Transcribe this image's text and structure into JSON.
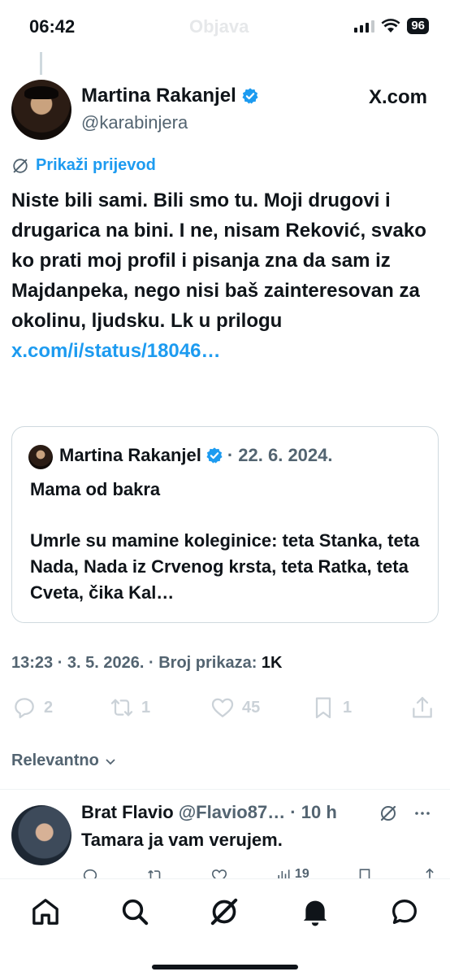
{
  "status_bar": {
    "time": "06:42",
    "title": "Objava",
    "battery": "96"
  },
  "tweet": {
    "author_name": "Martina Rakanjel",
    "author_handle": "@karabinjera",
    "source": "X.com",
    "translate_label": "Prikaži prijevod",
    "text": "Niste bili sami. Bili smo tu. Moji drugovi i drugarica na bini. I ne, nisam Reković, svako ko prati moj profil i pisanja zna da sam iz Majdanpeka, nego nisi baš zainteresovan za okolinu, ljudsku. Lk u prilogu ",
    "link": "x.com/i/status/18046…",
    "quote": {
      "author_name": "Martina Rakanjel",
      "date": "· 22. 6. 2024.",
      "line1": "Mama od bakra",
      "line2": "Umrle su mamine koleginice: teta Stanka, teta Nada, Nada iz Crvenog krsta, teta Ratka, teta Cveta, čika Kal…"
    },
    "meta_time": "13:23 · 3. 5. 2026. · Broj prikaza: ",
    "meta_views": "1K",
    "actions": {
      "replies": "2",
      "reposts": "1",
      "likes": "45",
      "bookmarks": "1"
    }
  },
  "sort_label": "Relevantno",
  "reply": {
    "author_name": "Brat Flavio",
    "meta": "@Flavio87… · 10 h",
    "text": "Tamara ja vam verujem.",
    "views": "19"
  },
  "colors": {
    "accent": "#1d9bf0",
    "text": "#0f1419",
    "muted": "#536471",
    "border": "#cfd9de"
  },
  "icons": [
    "home-icon",
    "search-icon",
    "grok-icon",
    "bell-icon",
    "messages-icon"
  ]
}
